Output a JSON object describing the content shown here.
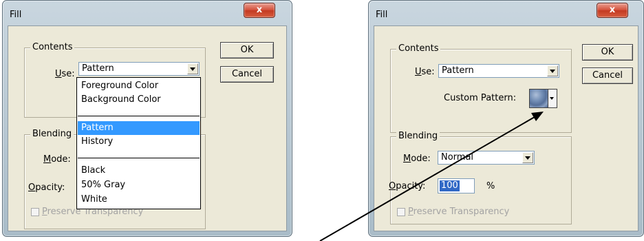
{
  "left_dialog": {
    "title": "Fill",
    "close_glyph": "x",
    "contents_label": "Contents",
    "use_label_u": "U",
    "use_label_rest": "se:",
    "use_value": "Pattern",
    "dropdown_options_group1": [
      "Foreground Color",
      "Background Color"
    ],
    "dropdown_options_group2": [
      "Pattern",
      "History"
    ],
    "dropdown_options_group3": [
      "Black",
      "50% Gray",
      "White"
    ],
    "selected_option": "Pattern",
    "blending_label": "Blending",
    "mode_label_u": "M",
    "mode_label_rest": "ode:",
    "opacity_label_u": "O",
    "opacity_label_rest": "pacity:",
    "preserve_label_u": "P",
    "preserve_label_rest": "reserve Transparency",
    "ok_label": "OK",
    "cancel_label": "Cancel"
  },
  "right_dialog": {
    "title": "Fill",
    "close_glyph": "x",
    "contents_label": "Contents",
    "use_label_u": "U",
    "use_label_rest": "se:",
    "use_value": "Pattern",
    "custom_pattern_label": "Custom Pattern:",
    "blending_label": "Blending",
    "mode_label_u": "M",
    "mode_label_rest": "ode:",
    "mode_value": "Normal",
    "opacity_label_u": "O",
    "opacity_label_rest": "pacity:",
    "opacity_value": "100",
    "opacity_unit": "%",
    "preserve_label_u": "P",
    "preserve_label_rest": "reserve Transparency",
    "ok_label": "OK",
    "cancel_label": "Cancel"
  },
  "colors": {
    "selection": "#3399ff",
    "close_button": "#d4503a",
    "dialog_face": "#ece9d8"
  },
  "icons": {
    "close": "close-icon",
    "dropdown": "chevron-down-icon",
    "annotation": "arrow-icon"
  }
}
